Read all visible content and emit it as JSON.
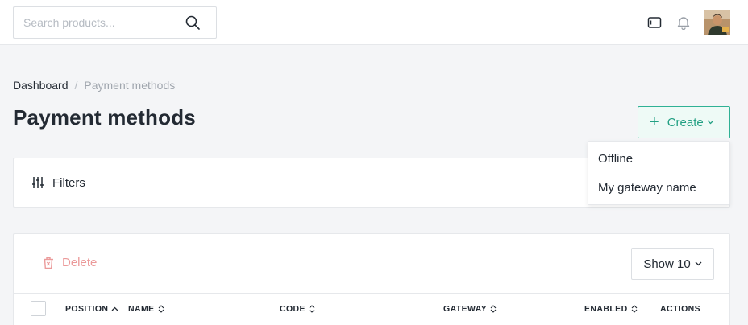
{
  "search": {
    "placeholder": "Search products..."
  },
  "icons": {
    "search": "search-icon",
    "window": "window-icon",
    "bell": "bell-icon",
    "avatar": "user-avatar",
    "plus": "plus-icon",
    "filters": "sliders-icon",
    "trash": "trash-icon",
    "chevron": "chevron-down-icon"
  },
  "breadcrumb": {
    "home": "Dashboard",
    "separator": "/",
    "current": "Payment methods"
  },
  "page": {
    "title": "Payment methods"
  },
  "create": {
    "plus": "+",
    "label": "Create",
    "menu": [
      "Offline",
      "My gateway name"
    ]
  },
  "filters": {
    "label": "Filters"
  },
  "toolbar": {
    "delete_label": "Delete",
    "show_label": "Show 10"
  },
  "table": {
    "columns": [
      "POSITION",
      "NAME",
      "CODE",
      "GATEWAY",
      "ENABLED",
      "ACTIONS"
    ]
  },
  "colors": {
    "accent": "#22a083",
    "accent_bg": "#eefaf6",
    "danger_soft": "#eb9a9a",
    "background": "#f4f5f7"
  }
}
